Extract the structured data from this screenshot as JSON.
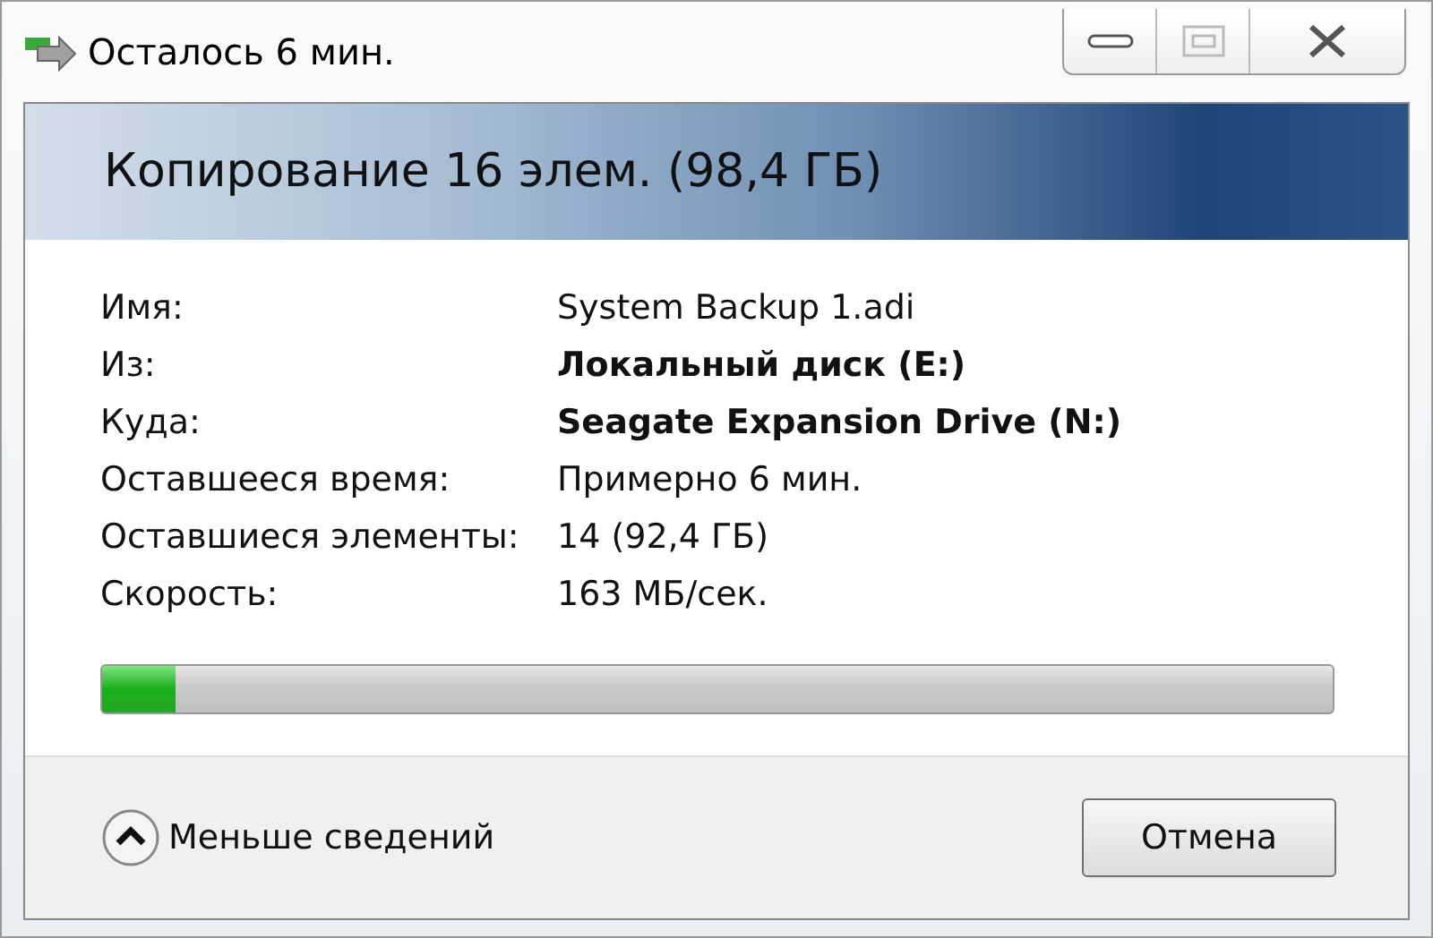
{
  "window": {
    "title": "Осталось 6 мин."
  },
  "header": {
    "title": "Копирование 16 элем. (98,4 ГБ)"
  },
  "details": [
    {
      "label": "Имя:",
      "value": "System Backup 1.adi",
      "bold": false
    },
    {
      "label": "Из:",
      "value": "Локальный диск (E:)",
      "bold": true
    },
    {
      "label": "Куда:",
      "value": "Seagate Expansion Drive (N:)",
      "bold": true
    },
    {
      "label": "Оставшееся время:",
      "value": "Примерно 6 мин.",
      "bold": false
    },
    {
      "label": "Оставшиеся элементы:",
      "value": "14 (92,4 ГБ)",
      "bold": false
    },
    {
      "label": "Скорость:",
      "value": "163 МБ/сек.",
      "bold": false
    }
  ],
  "progress": {
    "level": 0.06
  },
  "footer": {
    "toggle": "Меньше сведений",
    "cancel": "Отмена"
  }
}
